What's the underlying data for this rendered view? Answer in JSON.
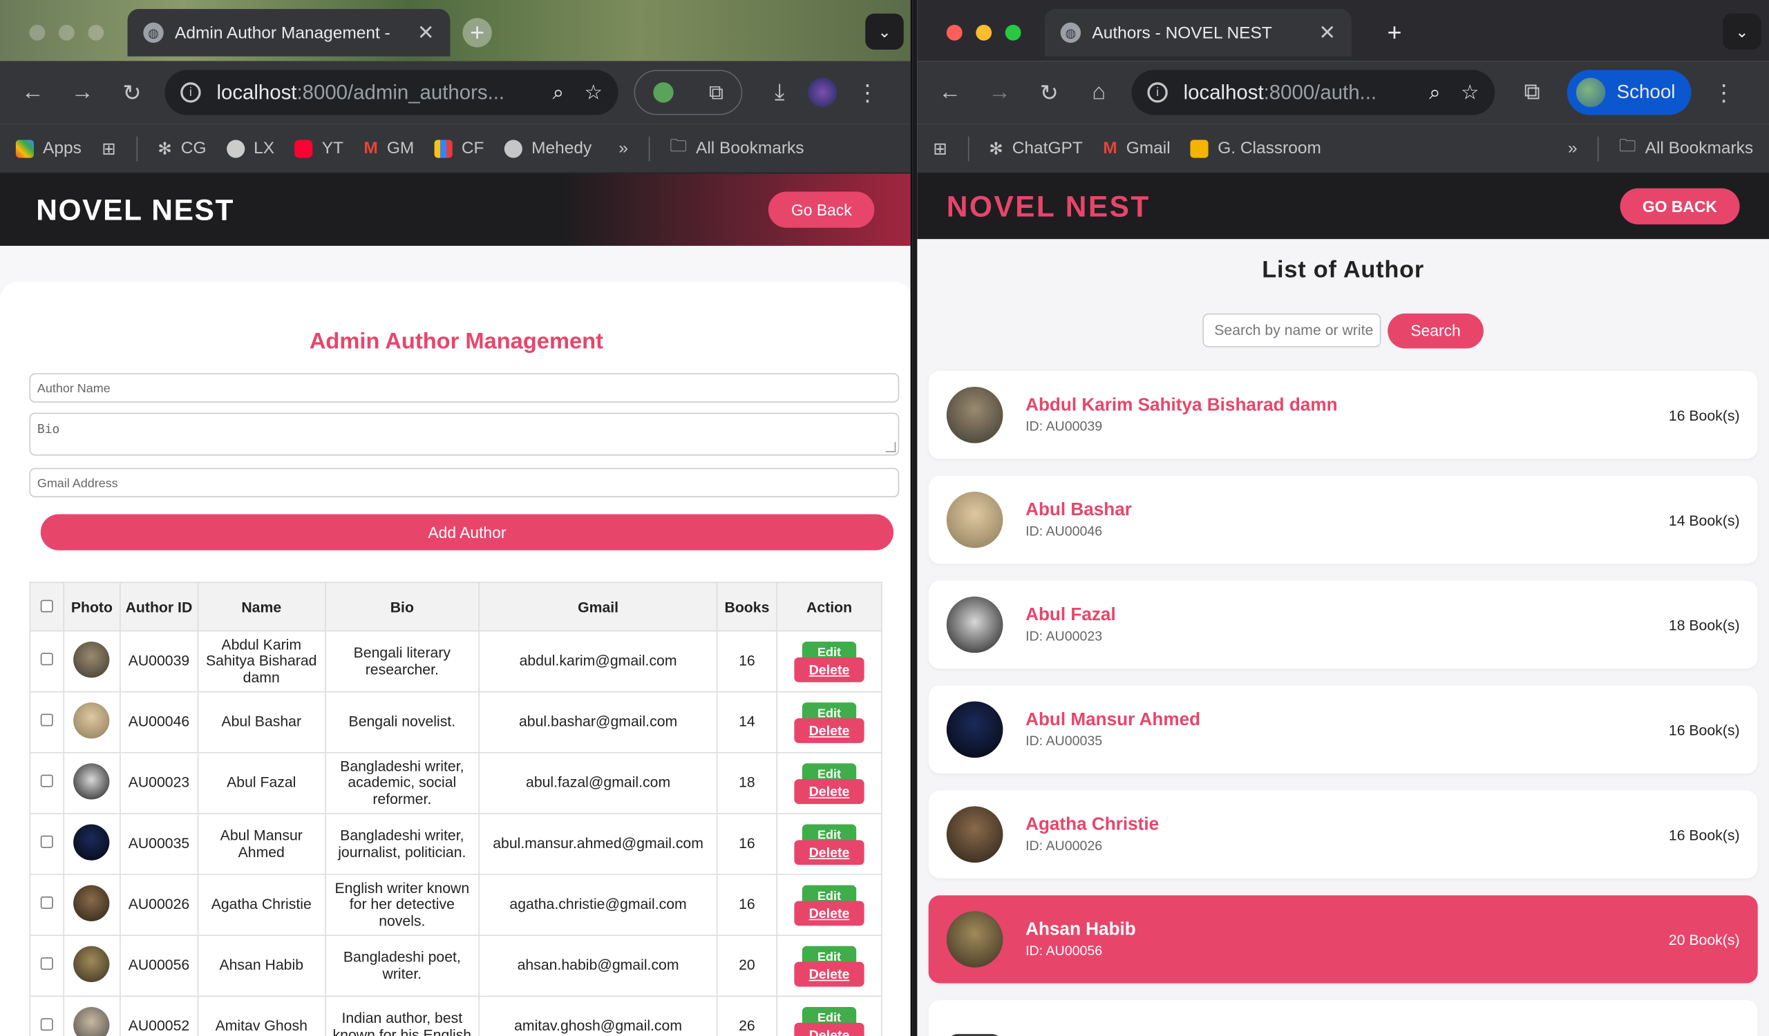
{
  "left_window": {
    "tab_title": "Admin Author Management -",
    "url_host": "localhost",
    "url_path": ":8000/admin_authors...",
    "bookmarks": [
      "Apps",
      "CG",
      "LX",
      "YT",
      "GM",
      "CF",
      "Mehedy",
      "All Bookmarks"
    ],
    "header": {
      "logo": "NOVEL NEST",
      "go_back": "Go Back"
    },
    "title": "Admin Author Management",
    "form": {
      "name_placeholder": "Author Name",
      "bio_placeholder": "Bio",
      "gmail_placeholder": "Gmail Address",
      "add_button": "Add Author"
    },
    "table": {
      "headers": [
        "Photo",
        "Author ID",
        "Name",
        "Bio",
        "Gmail",
        "Books",
        "Action"
      ],
      "edit_label": "Edit",
      "delete_label": "Delete",
      "rows": [
        {
          "id": "AU00039",
          "name": "Abdul Karim Sahitya Bisharad damn",
          "bio": "Bengali literary researcher.",
          "gmail": "abdul.karim@gmail.com",
          "books": "16"
        },
        {
          "id": "AU00046",
          "name": "Abul Bashar",
          "bio": "Bengali novelist.",
          "gmail": "abul.bashar@gmail.com",
          "books": "14"
        },
        {
          "id": "AU00023",
          "name": "Abul Fazal",
          "bio": "Bangladeshi writer, academic, social reformer.",
          "gmail": "abul.fazal@gmail.com",
          "books": "18"
        },
        {
          "id": "AU00035",
          "name": "Abul Mansur Ahmed",
          "bio": "Bangladeshi writer, journalist, politician.",
          "gmail": "abul.mansur.ahmed@gmail.com",
          "books": "16"
        },
        {
          "id": "AU00026",
          "name": "Agatha Christie",
          "bio": "English writer known for her detective novels.",
          "gmail": "agatha.christie@gmail.com",
          "books": "16"
        },
        {
          "id": "AU00056",
          "name": "Ahsan Habib",
          "bio": "Bangladeshi poet, writer.",
          "gmail": "ahsan.habib@gmail.com",
          "books": "20"
        },
        {
          "id": "AU00052",
          "name": "Amitav Ghosh",
          "bio": "Indian author, best known for his English",
          "gmail": "amitav.ghosh@gmail.com",
          "books": "26"
        }
      ]
    }
  },
  "right_window": {
    "tab_title": "Authors - NOVEL NEST",
    "url_host": "localhost",
    "url_path": ":8000/auth...",
    "profile_label": "School",
    "bookmarks": [
      "ChatGPT",
      "Gmail",
      "G. Classroom",
      "All Bookmarks"
    ],
    "header": {
      "logo": "NOVEL NEST",
      "go_back": "GO BACK"
    },
    "title": "List of Author",
    "search": {
      "placeholder": "Search by name or write",
      "button": "Search"
    },
    "authors": [
      {
        "name": "Abdul Karim Sahitya Bisharad damn",
        "id": "ID: AU00039",
        "books": "16 Book(s)"
      },
      {
        "name": "Abul Bashar",
        "id": "ID: AU00046",
        "books": "14 Book(s)"
      },
      {
        "name": "Abul Fazal",
        "id": "ID: AU00023",
        "books": "18 Book(s)"
      },
      {
        "name": "Abul Mansur Ahmed",
        "id": "ID: AU00035",
        "books": "16 Book(s)"
      },
      {
        "name": "Agatha Christie",
        "id": "ID: AU00026",
        "books": "16 Book(s)"
      },
      {
        "name": "Ahsan Habib",
        "id": "ID: AU00056",
        "books": "20 Book(s)"
      }
    ]
  },
  "colors": {
    "accent": "#e8456b",
    "header_dark": "#1d1d1f",
    "edit_green": "#3fae4a"
  },
  "icons": [
    "globe-icon",
    "close-icon",
    "plus-icon",
    "back-icon",
    "forward-icon",
    "reload-icon",
    "home-icon",
    "info-icon",
    "zoom-icon",
    "star-icon",
    "extension-icon",
    "download-icon",
    "menu-icon",
    "folder-icon",
    "chevron-down-icon"
  ]
}
